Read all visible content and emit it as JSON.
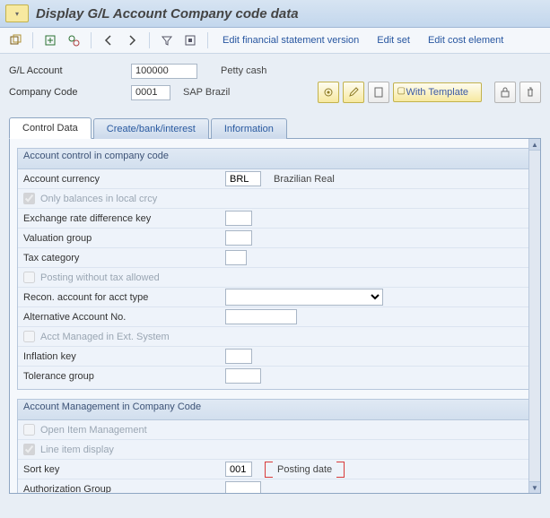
{
  "title": "Display G/L Account Company code data",
  "toolbar": {
    "edit_financial": "Edit financial statement version",
    "edit_set": "Edit set",
    "edit_cost": "Edit cost element"
  },
  "header": {
    "gl_label": "G/L Account",
    "gl_value": "100000",
    "gl_desc": "Petty cash",
    "cc_label": "Company Code",
    "cc_value": "0001",
    "cc_desc": "SAP Brazil",
    "with_template": "With Template"
  },
  "tabs": {
    "control": "Control Data",
    "bank": "Create/bank/interest",
    "info": "Information"
  },
  "group1": {
    "title": "Account control in company code",
    "currency_label": "Account currency",
    "currency_value": "BRL",
    "currency_desc": "Brazilian Real",
    "only_balances": "Only balances in local crcy",
    "exch_rate": "Exchange rate difference key",
    "val_group": "Valuation group",
    "tax_cat": "Tax category",
    "posting_wo_tax": "Posting without tax allowed",
    "recon": "Recon. account for acct type",
    "alt_acct": "Alternative Account No.",
    "ext_sys": "Acct Managed in Ext. System",
    "inflation": "Inflation key",
    "tolerance": "Tolerance group"
  },
  "group2": {
    "title": "Account Management in Company Code",
    "open_item": "Open Item Management",
    "line_item": "Line item display",
    "sort_key_label": "Sort key",
    "sort_key_value": "001",
    "sort_key_desc": "Posting date",
    "auth_group": "Authorization Group"
  }
}
